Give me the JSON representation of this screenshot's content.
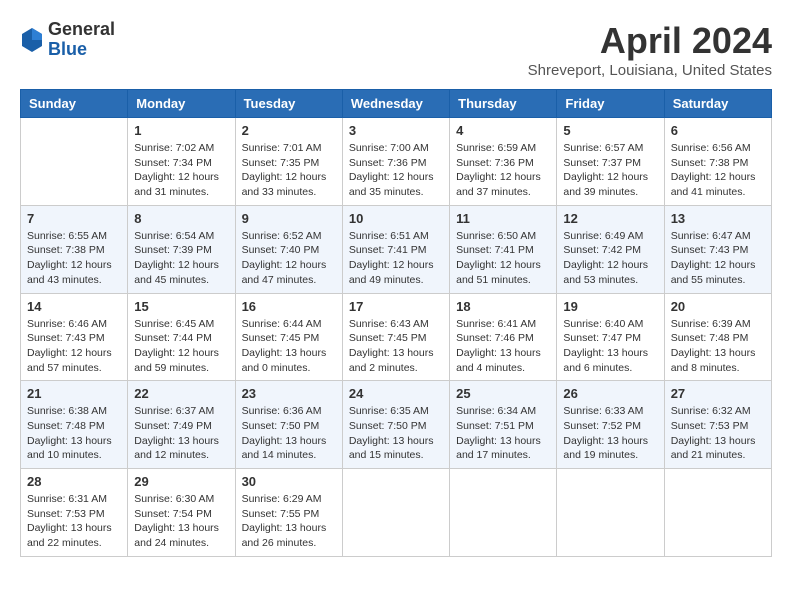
{
  "header": {
    "logo": {
      "line1": "General",
      "line2": "Blue"
    },
    "title": "April 2024",
    "location": "Shreveport, Louisiana, United States"
  },
  "weekdays": [
    "Sunday",
    "Monday",
    "Tuesday",
    "Wednesday",
    "Thursday",
    "Friday",
    "Saturday"
  ],
  "weeks": [
    [
      null,
      {
        "day": 1,
        "sunrise": "7:02 AM",
        "sunset": "7:34 PM",
        "daylight": "12 hours and 31 minutes."
      },
      {
        "day": 2,
        "sunrise": "7:01 AM",
        "sunset": "7:35 PM",
        "daylight": "12 hours and 33 minutes."
      },
      {
        "day": 3,
        "sunrise": "7:00 AM",
        "sunset": "7:36 PM",
        "daylight": "12 hours and 35 minutes."
      },
      {
        "day": 4,
        "sunrise": "6:59 AM",
        "sunset": "7:36 PM",
        "daylight": "12 hours and 37 minutes."
      },
      {
        "day": 5,
        "sunrise": "6:57 AM",
        "sunset": "7:37 PM",
        "daylight": "12 hours and 39 minutes."
      },
      {
        "day": 6,
        "sunrise": "6:56 AM",
        "sunset": "7:38 PM",
        "daylight": "12 hours and 41 minutes."
      }
    ],
    [
      {
        "day": 7,
        "sunrise": "6:55 AM",
        "sunset": "7:38 PM",
        "daylight": "12 hours and 43 minutes."
      },
      {
        "day": 8,
        "sunrise": "6:54 AM",
        "sunset": "7:39 PM",
        "daylight": "12 hours and 45 minutes."
      },
      {
        "day": 9,
        "sunrise": "6:52 AM",
        "sunset": "7:40 PM",
        "daylight": "12 hours and 47 minutes."
      },
      {
        "day": 10,
        "sunrise": "6:51 AM",
        "sunset": "7:41 PM",
        "daylight": "12 hours and 49 minutes."
      },
      {
        "day": 11,
        "sunrise": "6:50 AM",
        "sunset": "7:41 PM",
        "daylight": "12 hours and 51 minutes."
      },
      {
        "day": 12,
        "sunrise": "6:49 AM",
        "sunset": "7:42 PM",
        "daylight": "12 hours and 53 minutes."
      },
      {
        "day": 13,
        "sunrise": "6:47 AM",
        "sunset": "7:43 PM",
        "daylight": "12 hours and 55 minutes."
      }
    ],
    [
      {
        "day": 14,
        "sunrise": "6:46 AM",
        "sunset": "7:43 PM",
        "daylight": "12 hours and 57 minutes."
      },
      {
        "day": 15,
        "sunrise": "6:45 AM",
        "sunset": "7:44 PM",
        "daylight": "12 hours and 59 minutes."
      },
      {
        "day": 16,
        "sunrise": "6:44 AM",
        "sunset": "7:45 PM",
        "daylight": "13 hours and 0 minutes."
      },
      {
        "day": 17,
        "sunrise": "6:43 AM",
        "sunset": "7:45 PM",
        "daylight": "13 hours and 2 minutes."
      },
      {
        "day": 18,
        "sunrise": "6:41 AM",
        "sunset": "7:46 PM",
        "daylight": "13 hours and 4 minutes."
      },
      {
        "day": 19,
        "sunrise": "6:40 AM",
        "sunset": "7:47 PM",
        "daylight": "13 hours and 6 minutes."
      },
      {
        "day": 20,
        "sunrise": "6:39 AM",
        "sunset": "7:48 PM",
        "daylight": "13 hours and 8 minutes."
      }
    ],
    [
      {
        "day": 21,
        "sunrise": "6:38 AM",
        "sunset": "7:48 PM",
        "daylight": "13 hours and 10 minutes."
      },
      {
        "day": 22,
        "sunrise": "6:37 AM",
        "sunset": "7:49 PM",
        "daylight": "13 hours and 12 minutes."
      },
      {
        "day": 23,
        "sunrise": "6:36 AM",
        "sunset": "7:50 PM",
        "daylight": "13 hours and 14 minutes."
      },
      {
        "day": 24,
        "sunrise": "6:35 AM",
        "sunset": "7:50 PM",
        "daylight": "13 hours and 15 minutes."
      },
      {
        "day": 25,
        "sunrise": "6:34 AM",
        "sunset": "7:51 PM",
        "daylight": "13 hours and 17 minutes."
      },
      {
        "day": 26,
        "sunrise": "6:33 AM",
        "sunset": "7:52 PM",
        "daylight": "13 hours and 19 minutes."
      },
      {
        "day": 27,
        "sunrise": "6:32 AM",
        "sunset": "7:53 PM",
        "daylight": "13 hours and 21 minutes."
      }
    ],
    [
      {
        "day": 28,
        "sunrise": "6:31 AM",
        "sunset": "7:53 PM",
        "daylight": "13 hours and 22 minutes."
      },
      {
        "day": 29,
        "sunrise": "6:30 AM",
        "sunset": "7:54 PM",
        "daylight": "13 hours and 24 minutes."
      },
      {
        "day": 30,
        "sunrise": "6:29 AM",
        "sunset": "7:55 PM",
        "daylight": "13 hours and 26 minutes."
      },
      null,
      null,
      null,
      null
    ]
  ],
  "labels": {
    "sunrise": "Sunrise:",
    "sunset": "Sunset:",
    "daylight": "Daylight:"
  }
}
